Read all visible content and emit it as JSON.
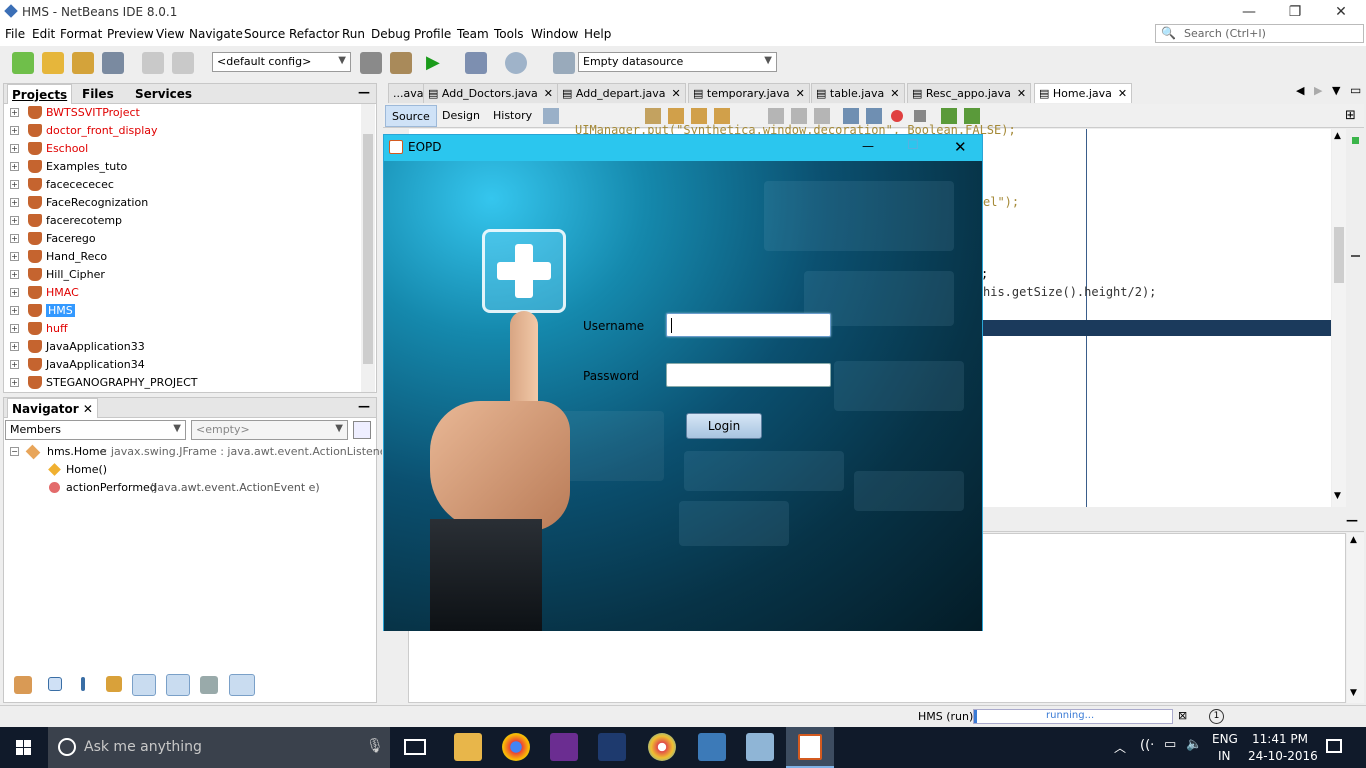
{
  "window": {
    "title": "HMS - NetBeans IDE 8.0.1",
    "minimize": "—",
    "restore": "❐",
    "close": "✕"
  },
  "menu": [
    "File",
    "Edit",
    "Format",
    "Preview",
    "View",
    "Navigate",
    "Source",
    "Refactor",
    "Run",
    "Debug",
    "Profile",
    "Team",
    "Tools",
    "Window",
    "Help"
  ],
  "search": {
    "placeholder": "Search (Ctrl+I)"
  },
  "toolbar": {
    "config_value": "<default config>",
    "datasource_value": "Empty datasource"
  },
  "projects_panel": {
    "tabs": [
      "Projects",
      "Files",
      "Services"
    ],
    "minimize": "—",
    "items": [
      {
        "label": "BWTSSVITProject",
        "error": true
      },
      {
        "label": "doctor_front_display",
        "error": true
      },
      {
        "label": "Eschool",
        "error": true
      },
      {
        "label": "Examples_tuto",
        "error": false
      },
      {
        "label": "facecececec",
        "error": false
      },
      {
        "label": "FaceRecognization",
        "error": false
      },
      {
        "label": "facerecotemp",
        "error": false
      },
      {
        "label": "Facerego",
        "error": false
      },
      {
        "label": "Hand_Reco",
        "error": false
      },
      {
        "label": "Hill_Cipher",
        "error": false
      },
      {
        "label": "HMAC",
        "error": true
      },
      {
        "label": "HMS",
        "error": false,
        "selected": true
      },
      {
        "label": "huff",
        "error": true
      },
      {
        "label": "JavaApplication33",
        "error": false
      },
      {
        "label": "JavaApplication34",
        "error": false
      },
      {
        "label": "STEGANOGRAPHY_PROJECT",
        "error": false
      }
    ]
  },
  "navigator": {
    "title": "Navigator",
    "close": "✕",
    "minimize": "—",
    "members_value": "Members",
    "filter_value": "<empty>",
    "class_name": "hms.Home",
    "class_sig": " :: javax.swing.JFrame : java.awt.event.ActionListener",
    "constructor": "Home()",
    "method_name": "actionPerformed",
    "method_params": "(java.awt.event.ActionEvent e)"
  },
  "editor": {
    "tabs": [
      {
        "label": "...ava"
      },
      {
        "label": "Add_Doctors.java"
      },
      {
        "label": "Add_depart.java"
      },
      {
        "label": "temporary.java"
      },
      {
        "label": "table.java"
      },
      {
        "label": "Resc_appo.java"
      },
      {
        "label": "Home.java",
        "active": true
      }
    ],
    "subtabs": [
      "Source",
      "Design",
      "History"
    ],
    "code_lines": [
      {
        "text": "UIManager.put(\"Synthetica.window.decoration\", Boolean.FALSE);"
      },
      {
        "text": "el\");"
      },
      {
        "text": ";"
      },
      {
        "text": "his.getSize().height/2);"
      }
    ]
  },
  "dialog": {
    "title": "EOPD",
    "minimize": "—",
    "maximize": "☐",
    "close": "✕",
    "username_label": "Username",
    "password_label": "Password",
    "username_value": "",
    "password_value": "",
    "login_label": "Login"
  },
  "status": {
    "run_label": "HMS (run)",
    "progress_text": "running...",
    "notifications": "1"
  },
  "taskbar": {
    "search_placeholder": "Ask me anything",
    "lang": "ENG",
    "region": "IN",
    "time": "11:41 PM",
    "date": "24-10-2016"
  },
  "colors": {
    "dialog_title_bg": "#2bc6ee",
    "selection": "#3399ff",
    "error_text": "#e00000",
    "taskbar_bg": "#101a2a"
  }
}
